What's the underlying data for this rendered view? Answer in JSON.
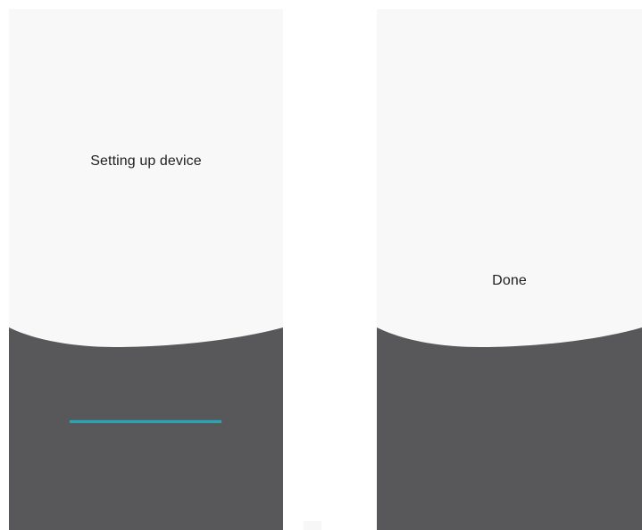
{
  "screens": [
    {
      "id": "setting-up",
      "status_text": "Setting up device",
      "progress": 1.0
    },
    {
      "id": "done",
      "status_text": "Done"
    }
  ],
  "colors": {
    "top_background": "#f8f8f8",
    "bottom_background": "#58585a",
    "text": "#1f1f1f",
    "progress_accent": "#2aa3b3"
  }
}
